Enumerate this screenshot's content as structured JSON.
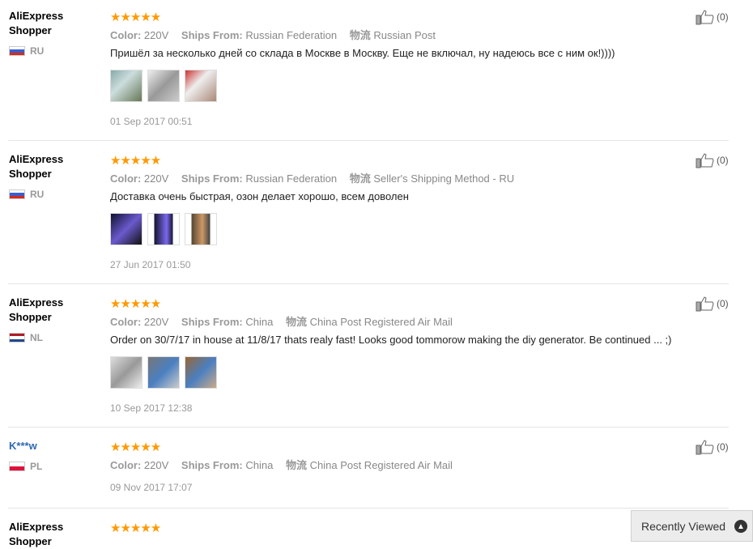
{
  "labels": {
    "color": "Color:",
    "ships_from": "Ships From:",
    "logistics": "物流",
    "recently_viewed": "Recently Viewed"
  },
  "reviews": [
    {
      "user_line1": "AliExpress",
      "user_line2": "Shopper",
      "country": "RU",
      "rating": "★★★★★",
      "color": "220V",
      "ships_from": "Russian Federation",
      "logistics": "Russian Post",
      "text": "Пришёл за несколько дней со склада в Москве в Москву. Еще не включал, ну надеюсь все с ним ок!))))",
      "date": "01 Sep 2017 00:51",
      "likes": "(0)"
    },
    {
      "user_line1": "AliExpress",
      "user_line2": "Shopper",
      "country": "RU",
      "rating": "★★★★★",
      "color": "220V",
      "ships_from": "Russian Federation",
      "logistics": "Seller's Shipping Method - RU",
      "text": "Доставка очень быстрая, озон делает хорошо, всем доволен",
      "date": "27 Jun 2017 01:50",
      "likes": "(0)"
    },
    {
      "user_line1": "AliExpress",
      "user_line2": "Shopper",
      "country": "NL",
      "rating": "★★★★★",
      "color": "220V",
      "ships_from": "China",
      "logistics": "China Post Registered Air Mail",
      "text": "Order on 30/7/17 in house at 11/8/17 thats realy fast! Looks good tommorow making the diy generator. Be continued ... ;)",
      "date": "10 Sep 2017 12:38",
      "likes": "(0)"
    },
    {
      "user_line1": "K***w",
      "country": "PL",
      "rating": "★★★★★",
      "color": "220V",
      "ships_from": "China",
      "logistics": "China Post Registered Air Mail",
      "date": "09 Nov 2017 17:07",
      "likes": "(0)"
    },
    {
      "user_line1": "AliExpress",
      "user_line2": "Shopper",
      "rating": "★★★★★"
    }
  ]
}
